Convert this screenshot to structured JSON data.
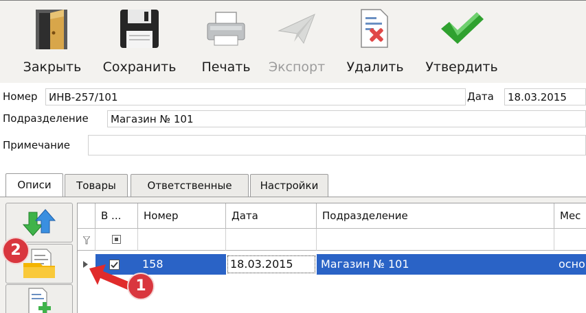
{
  "toolbar": {
    "close_label": "Закрыть",
    "save_label": "Сохранить",
    "print_label": "Печать",
    "export_label": "Экспорт",
    "delete_label": "Удалить",
    "approve_label": "Утвердить"
  },
  "form": {
    "number_label": "Номер",
    "number_value": "ИНВ-257/101",
    "date_label": "Дата",
    "date_value": "18.03.2015",
    "department_label": "Подразделение",
    "department_value": "Магазин № 101",
    "note_label": "Примечание",
    "note_value": ""
  },
  "tabs": [
    "Описи",
    "Товары",
    "Ответственные",
    "Настройки"
  ],
  "grid": {
    "columns": [
      "В ...",
      "Номер",
      "Дата",
      "Подразделение",
      "Мес"
    ],
    "rows": [
      {
        "checked": true,
        "number": "158",
        "date": "18.03.2015",
        "department": "Магазин № 101",
        "extra": "осно"
      }
    ]
  },
  "annotations": [
    "1",
    "2"
  ],
  "colors": {
    "selection": "#2a63c6",
    "badge": "#d9363e",
    "approve_green": "#2fa12f",
    "delete_red": "#e04848"
  }
}
